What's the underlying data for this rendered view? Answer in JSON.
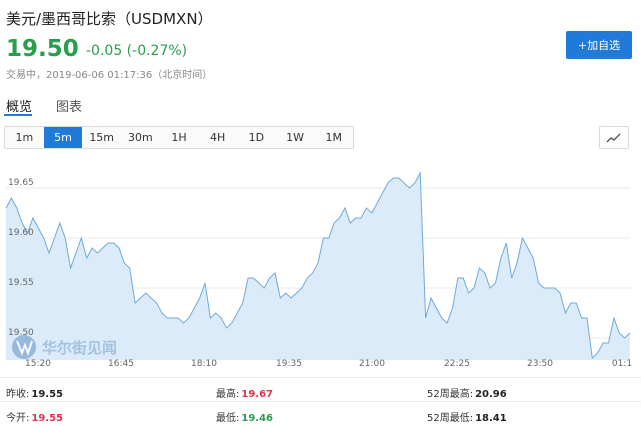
{
  "header": {
    "title": "美元/墨西哥比索（USDMXN）",
    "price": "19.50",
    "change": "-0.05 (-0.27%)",
    "status": "交易中，2019-06-06 01:17:36（北京时间）",
    "add_button": "+加自选"
  },
  "tabs": [
    {
      "label": "概览",
      "active": true
    },
    {
      "label": "图表",
      "active": false
    }
  ],
  "ranges": [
    "1m",
    "5m",
    "15m",
    "30m",
    "1H",
    "4H",
    "1D",
    "1W",
    "1M"
  ],
  "active_range": "5m",
  "watermark": "华尔街见闻",
  "stats": {
    "prev_close_label": "昨收:",
    "prev_close": "19.55",
    "high_label": "最高:",
    "high": "19.67",
    "week52_high_label": "52周最高:",
    "week52_high": "20.96",
    "open_label": "今开:",
    "open": "19.55",
    "low_label": "最低:",
    "low": "19.46",
    "week52_low_label": "52周最低:",
    "week52_low": "18.41"
  },
  "colors": {
    "accent": "#1f7ad9",
    "up": "#e0334a",
    "down": "#2a9d4e",
    "line": "#6ea9dc",
    "fill": "#dcebfa"
  },
  "chart_data": {
    "type": "area",
    "ytick_labels": [
      "19.50",
      "19.55",
      "19.60",
      "19.65"
    ],
    "yticks": [
      19.5,
      19.55,
      19.6,
      19.65
    ],
    "xtick_labels": [
      "15:20",
      "16:45",
      "18:10",
      "19:35",
      "21:00",
      "22:25",
      "23:50",
      "01:1"
    ],
    "ylim": [
      19.478,
      19.676
    ],
    "values": [
      19.63,
      19.64,
      19.63,
      19.615,
      19.605,
      19.62,
      19.61,
      19.6,
      19.585,
      19.6,
      19.615,
      19.6,
      19.57,
      19.585,
      19.6,
      19.58,
      19.59,
      19.585,
      19.59,
      19.595,
      19.595,
      19.59,
      19.575,
      19.57,
      19.535,
      19.54,
      19.545,
      19.54,
      19.535,
      19.525,
      19.52,
      19.52,
      19.52,
      19.515,
      19.52,
      19.53,
      19.54,
      19.555,
      19.52,
      19.525,
      19.52,
      19.51,
      19.515,
      19.525,
      19.535,
      19.56,
      19.56,
      19.555,
      19.55,
      19.56,
      19.565,
      19.54,
      19.545,
      19.54,
      19.545,
      19.55,
      19.56,
      19.565,
      19.575,
      19.6,
      19.6,
      19.615,
      19.62,
      19.63,
      19.615,
      19.62,
      19.62,
      19.63,
      19.625,
      19.635,
      19.645,
      19.655,
      19.66,
      19.66,
      19.655,
      19.65,
      19.655,
      19.665,
      19.52,
      19.54,
      19.53,
      19.52,
      19.515,
      19.53,
      19.56,
      19.56,
      19.545,
      19.55,
      19.57,
      19.565,
      19.55,
      19.555,
      19.58,
      19.595,
      19.56,
      19.575,
      19.6,
      19.59,
      19.58,
      19.555,
      19.55,
      19.55,
      19.55,
      19.545,
      19.525,
      19.535,
      19.535,
      19.52,
      19.52,
      19.48,
      19.485,
      19.495,
      19.495,
      19.52,
      19.505,
      19.5,
      19.505
    ]
  }
}
